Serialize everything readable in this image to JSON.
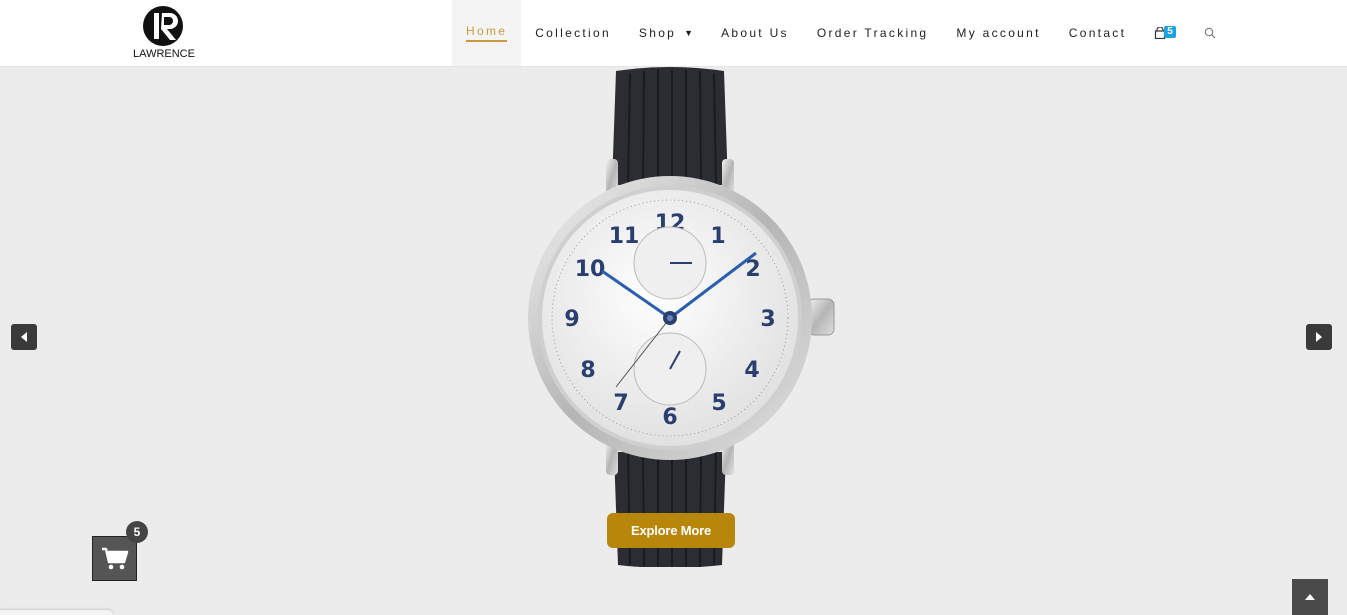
{
  "brand": {
    "name": "LAWRENCE"
  },
  "nav": {
    "items": [
      {
        "label": "Home",
        "active": true
      },
      {
        "label": "Collection"
      },
      {
        "label": "Shop",
        "dropdown": true
      },
      {
        "label": "About Us"
      },
      {
        "label": "Order Tracking"
      },
      {
        "label": "My account"
      },
      {
        "label": "Contact"
      }
    ],
    "cart_count": "5",
    "cart_icon": "shopping-bag-icon",
    "search_icon": "search-icon"
  },
  "slider": {
    "button_label": "Explore More",
    "prev_icon": "chevron-left-icon",
    "next_icon": "chevron-right-icon"
  },
  "floating_cart": {
    "count": "5",
    "icon": "shopping-cart-icon"
  },
  "colors": {
    "accent": "#c89a3b",
    "button": "#b8860b",
    "badge": "#1da1e2"
  }
}
